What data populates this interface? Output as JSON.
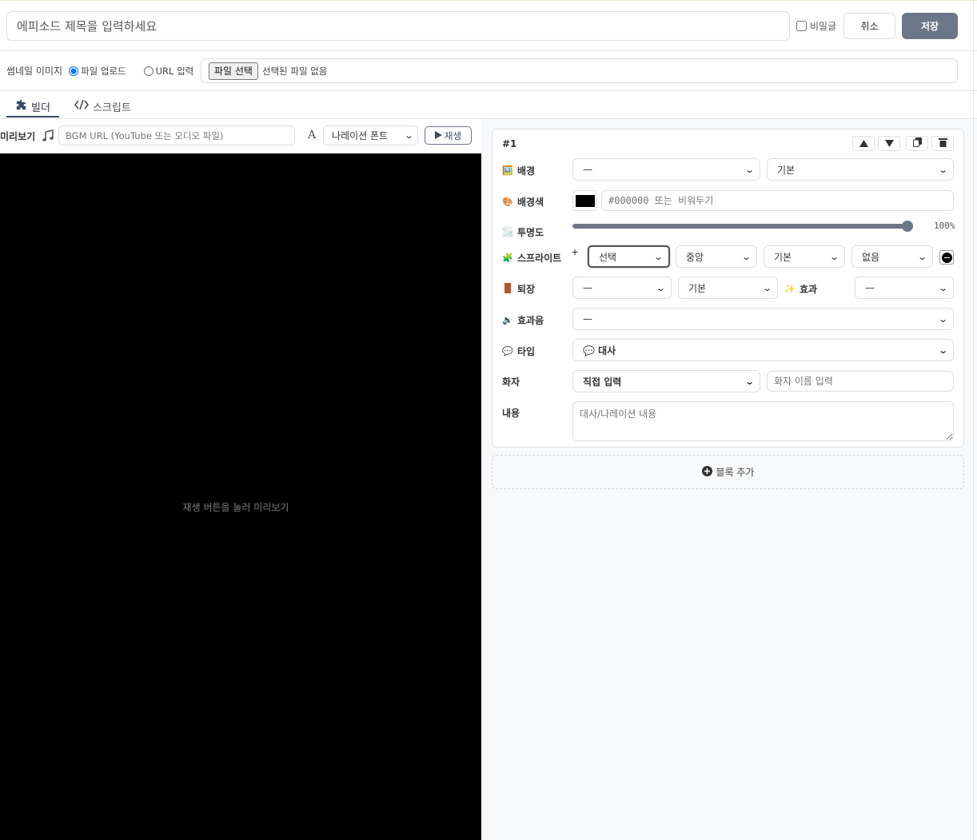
{
  "header": {
    "title_placeholder": "에피소드 제목을 입력하세요",
    "secret_label": "비밀글",
    "cancel_label": "취소",
    "save_label": "저장"
  },
  "thumbnail": {
    "label": "썸네일 이미지",
    "option_upload": "파일 업로드",
    "option_url": "URL 입력",
    "file_button": "파일 선택",
    "file_status": "선택된 파일 없음"
  },
  "tabs": [
    {
      "label": "빌더",
      "icon": "puzzle-icon",
      "active": true
    },
    {
      "label": "스크립트",
      "icon": "code-icon",
      "active": false
    }
  ],
  "preview": {
    "label": "미리보기",
    "bgm_placeholder": "BGM URL (YouTube 또는 오디오 파일)",
    "font_select": "나레이션 폰트",
    "play_label": "재생",
    "hint": "재생 버튼을 눌러 미리보기"
  },
  "block": {
    "number": "#1",
    "rows": {
      "background": {
        "label": "배경",
        "icon": "image-icon",
        "value": "—",
        "mode": "기본"
      },
      "bg_color": {
        "label": "배경색",
        "icon": "palette-icon",
        "swatch": "#000000",
        "placeholder": "#000000 또는 비워두기"
      },
      "opacity": {
        "label": "투명도",
        "icon": "opacity-icon",
        "value": "100%",
        "level": 1.0
      },
      "sprite": {
        "label": "스프라이트",
        "icon": "puzzle-piece-icon",
        "select": "선택",
        "position": "중앙",
        "size": "기본",
        "effect": "없음"
      },
      "exit": {
        "label": "퇴장",
        "icon": "door-icon",
        "value": "—",
        "mode": "기본",
        "effect_label": "효과",
        "effect_value": "—"
      },
      "sfx": {
        "label": "효과음",
        "icon": "speaker-icon",
        "value": "—"
      },
      "type": {
        "label": "타입",
        "icon": "speech-bubble-icon",
        "value": "💬  대사"
      },
      "speaker": {
        "label": "화자",
        "select": "직접 입력",
        "placeholder": "화자 이름 입력"
      },
      "content": {
        "label": "내용",
        "placeholder": "대사/나레이션 내용"
      }
    }
  },
  "add_block_label": "블록 추가",
  "colors": {
    "accent": "#6c7689",
    "stage": "#000000",
    "panel_bg": "#f8f9fa"
  }
}
